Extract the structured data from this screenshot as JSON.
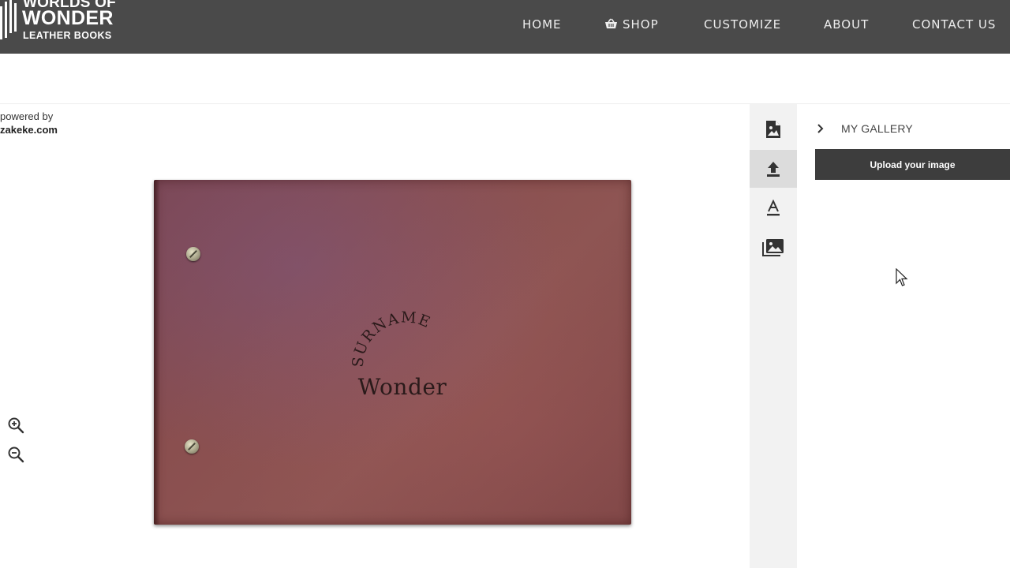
{
  "brand": {
    "line1": "WORLDS OF",
    "line2": "WONDER",
    "line3": "LEATHER BOOKS"
  },
  "nav": {
    "items": [
      {
        "label": "HOME",
        "icon": "none"
      },
      {
        "label": "SHOP",
        "icon": "basket-icon"
      },
      {
        "label": "CUSTOMIZE",
        "icon": "none"
      },
      {
        "label": "ABOUT",
        "icon": "none"
      },
      {
        "label": "CONTACT US",
        "icon": "none"
      }
    ]
  },
  "editor": {
    "powered_by": "powered by",
    "powered_brand": "zakeke.com",
    "zoom_in_icon": "zoom-in-icon",
    "zoom_out_icon": "zoom-out-icon"
  },
  "product": {
    "engraving_arc_text": "SURNAME",
    "engraving_name": "Wonder",
    "leather_color": "#8a4f4f"
  },
  "tools": [
    {
      "name": "image-icon",
      "active": false
    },
    {
      "name": "upload-icon",
      "active": true
    },
    {
      "name": "text-icon",
      "active": false
    },
    {
      "name": "gallery-icon",
      "active": false
    }
  ],
  "panel": {
    "title": "MY GALLERY",
    "upload_label": "Upload your image"
  },
  "colors": {
    "header_bg": "#4a4a4a",
    "rail_bg": "#f2f2f2",
    "button_bg": "#3d3d3d"
  }
}
